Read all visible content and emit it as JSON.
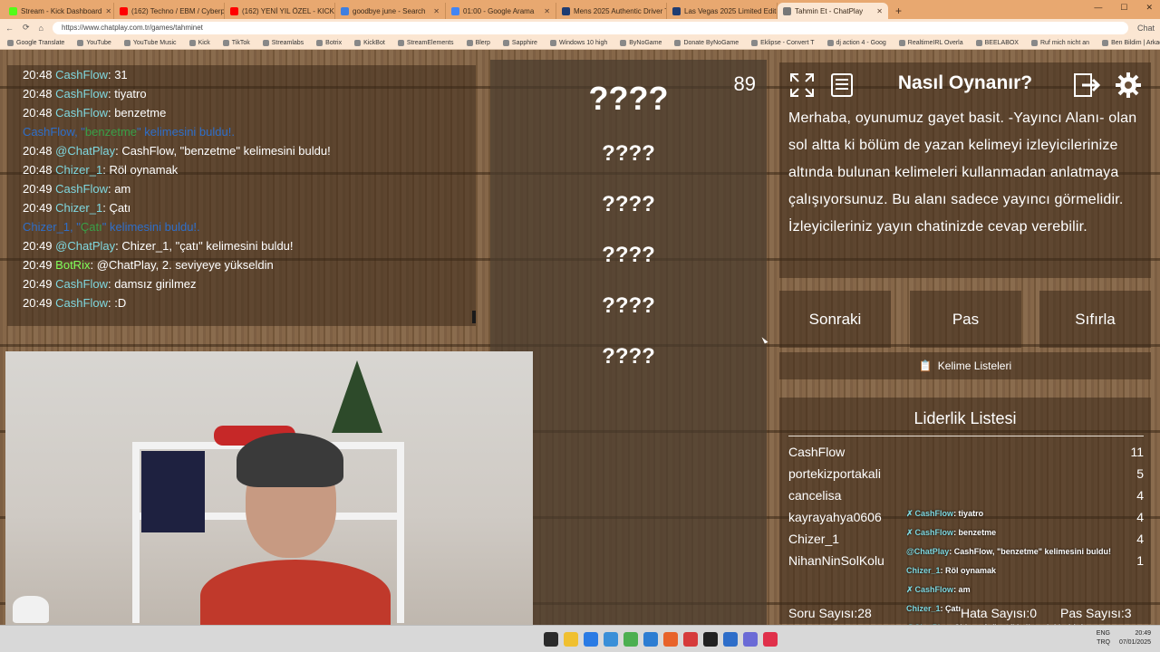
{
  "browser": {
    "tabs": [
      {
        "title": "Stream - Kick Dashboard",
        "color": "#53fc18",
        "active": false
      },
      {
        "title": "(162) Techno / EBM / Cyberpu",
        "color": "#ff0000",
        "active": false
      },
      {
        "title": "(162) YENİ YIL ÖZEL - KICK WRAP",
        "color": "#ff0000",
        "active": false
      },
      {
        "title": "goodbye june - Search",
        "color": "#3f7fe0",
        "active": false
      },
      {
        "title": "01:00 - Google Arama",
        "color": "#4285f4",
        "active": false
      },
      {
        "title": "Mens 2025 Authentic Driver Tee",
        "color": "#1e3c72",
        "active": false
      },
      {
        "title": "Las Vegas 2025 Limited Edition T",
        "color": "#1e3c72",
        "active": false
      },
      {
        "title": "Tahmin Et - ChatPlay",
        "color": "#777777",
        "active": true
      }
    ],
    "new_tab": "+",
    "url": "https://www.chatplay.com.tr/games/tahminet",
    "chat_label": "Chat",
    "bookmarks": [
      "Google Translate",
      "YouTube",
      "YouTube Music",
      "Kick",
      "TikTok",
      "Streamlabs",
      "Botrix",
      "KickBot",
      "StreamElements",
      "Blerp",
      "Sapphire",
      "Windows 10 high",
      "ByNoGame",
      "Donate ByNoGame",
      "Eklipse - Convert T",
      "dj action 4 - Goog",
      "RealtimeIRL Overla",
      "BEELABOX",
      "Ruf mich nicht an",
      "Ben Bildim | Arkad"
    ],
    "other_favourites": "Other favourites"
  },
  "chat": {
    "lines": [
      {
        "kind": "msg",
        "time": "20:48",
        "user": "CashFlow",
        "sep": ":",
        "text": " 31"
      },
      {
        "kind": "msg",
        "time": "20:48",
        "user": "CashFlow",
        "sep": ":",
        "text": " tiyatro"
      },
      {
        "kind": "msg",
        "time": "20:48",
        "user": "CashFlow",
        "sep": ":",
        "text": " benzetme"
      },
      {
        "kind": "sys",
        "pre": "CashFlow, \"",
        "word": "benzetme",
        "post": "\" kelimesini buldu!."
      },
      {
        "kind": "msg",
        "time": "20:48",
        "user": "@ChatPlay",
        "sep": ":",
        "text": " CashFlow, \"benzetme\" kelimesini buldu!"
      },
      {
        "kind": "msg",
        "time": "20:48",
        "user": "Chizer_1",
        "sep": ":",
        "text": " Röl oynamak"
      },
      {
        "kind": "msg",
        "time": "20:49",
        "user": "CashFlow",
        "sep": ":",
        "text": " am"
      },
      {
        "kind": "msg",
        "time": "20:49",
        "user": "Chizer_1",
        "sep": ":",
        "text": " Çatı"
      },
      {
        "kind": "sys",
        "pre": "Chizer_1, \"",
        "word": "Çatı",
        "post": "\" kelimesini buldu!."
      },
      {
        "kind": "msg",
        "time": "20:49",
        "user": "@ChatPlay",
        "sep": ":",
        "text": " Chizer_1, \"çatı\" kelimesini buldu!"
      },
      {
        "kind": "bot",
        "time": "20:49",
        "user": "BotRix",
        "sep": ":",
        "text": " @ChatPlay, 2. seviyeye yükseldin"
      },
      {
        "kind": "msg",
        "time": "20:49",
        "user": "CashFlow",
        "sep": ":",
        "text": " damsız girilmez"
      },
      {
        "kind": "msg",
        "time": "20:49",
        "user": "CashFlow",
        "sep": ":",
        "text": " :D"
      }
    ]
  },
  "game": {
    "counter": "89",
    "hidden_words": [
      "????",
      "????",
      "????",
      "????",
      "????",
      "????"
    ]
  },
  "howto": {
    "title": "Nasıl Oynanır?",
    "text": "Merhaba, oyunumuz gayet basit. -Yayıncı Alanı- olan sol altta ki bölüm de yazan kelimeyi izleyicilerinize altında bulunan kelimeleri kullanmadan anlatmaya çalışıyorsunuz. Bu alanı sadece yayıncı görmelidir. İzleyicileriniz yayın chatinizde cevap verebilir."
  },
  "buttons": {
    "next": "Sonraki",
    "pass": "Pas",
    "reset": "Sıfırla",
    "word_lists": "Kelime Listeleri"
  },
  "leaderboard": {
    "title": "Liderlik Listesi",
    "rows": [
      {
        "name": "CashFlow",
        "score": "11"
      },
      {
        "name": "portekizportakali",
        "score": "5"
      },
      {
        "name": "cancelisa",
        "score": "4"
      },
      {
        "name": "kayrayahya0606",
        "score": "4"
      },
      {
        "name": "Chizer_1",
        "score": "4"
      },
      {
        "name": "NihanNinSolKolu",
        "score": "1"
      }
    ],
    "question_count": "Soru Sayısı:28",
    "error_count": "Hata Sayısı:0",
    "pass_count": "Pas Sayısı:3"
  },
  "overlay": [
    {
      "user": "CashFlow",
      "text": ": tiyatro",
      "badge": true
    },
    {
      "user": "CashFlow",
      "text": ": benzetme",
      "badge": true
    },
    {
      "user": "@ChatPlay",
      "text": ": CashFlow, \"benzetme\" kelimesini buldu!",
      "badge": false
    },
    {
      "user": "Chizer_1",
      "text": ": Röl oynamak",
      "badge": false
    },
    {
      "user": "CashFlow",
      "text": ": am",
      "badge": true
    },
    {
      "user": "Chizer_1",
      "text": ": Çatı",
      "badge": false
    },
    {
      "user": "@ChatPlay",
      "text": ": Chizer_1, \"çatı\" kelimesini buldu!",
      "badge": false
    },
    {
      "user": "BotRix",
      "text": ": @ChatPlay, 2. seviyeye yükseldin",
      "badge": true
    },
    {
      "user": "CashFlow",
      "text": ": damsız girilmez",
      "badge": true
    }
  ],
  "taskbar": {
    "lang": "ENG",
    "lang2": "TRQ",
    "time": "20:49",
    "date": "07/01/2025"
  },
  "colors": {
    "user": "#7fd8e0",
    "bot": "#7fff5a",
    "system": "#2e6ec9",
    "found_word": "#38a048",
    "tab_bar": "#e8a870"
  }
}
